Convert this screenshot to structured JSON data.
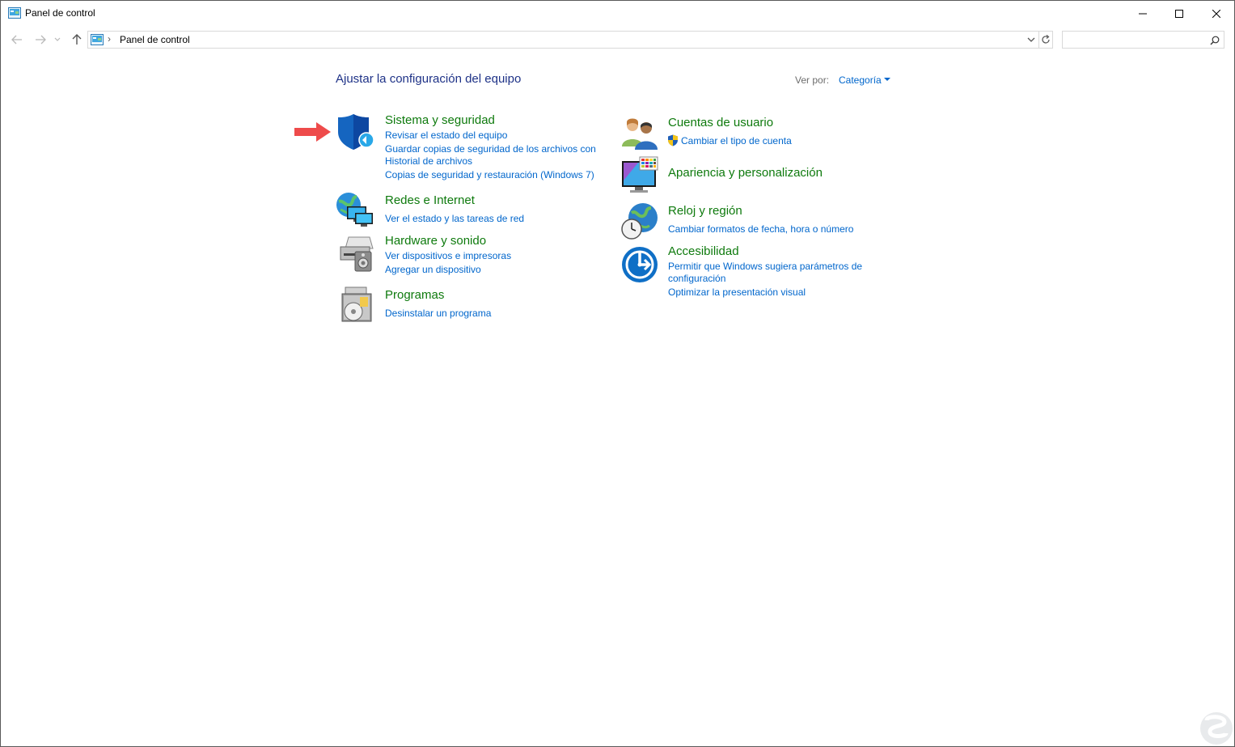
{
  "window": {
    "title": "Panel de control",
    "controls": [
      "minimize",
      "maximize",
      "close"
    ]
  },
  "nav": {
    "back_icon": "arrow-left-icon",
    "forward_icon": "arrow-right-icon",
    "recent_icon": "chevron-down-icon",
    "up_icon": "arrow-up-icon"
  },
  "address": {
    "separator": "›",
    "path": "Panel de control"
  },
  "search": {
    "placeholder": ""
  },
  "main": {
    "heading": "Ajustar la configuración del equipo",
    "view_by_label": "Ver por:",
    "view_by_value": "Categoría"
  },
  "categories_left": [
    {
      "title": "Sistema y seguridad",
      "icon": "shield-icon",
      "links": [
        "Revisar el estado del equipo",
        "Guardar copias de seguridad de los archivos con",
        "Historial de archivos",
        "Copias de seguridad y restauración (Windows 7)"
      ]
    },
    {
      "title": "Redes e Internet",
      "icon": "network-globe-icon",
      "links": [
        "Ver el estado y las tareas de red"
      ]
    },
    {
      "title": "Hardware y sonido",
      "icon": "printer-speaker-icon",
      "links": [
        "Ver dispositivos e impresoras",
        "Agregar un dispositivo"
      ]
    },
    {
      "title": "Programas",
      "icon": "programs-disc-icon",
      "links": [
        "Desinstalar un programa"
      ]
    }
  ],
  "categories_right": [
    {
      "title": "Cuentas de usuario",
      "icon": "users-icon",
      "links": [
        "Cambiar el tipo de cuenta"
      ]
    },
    {
      "title": "Apariencia y personalización",
      "icon": "monitor-palette-icon",
      "links": []
    },
    {
      "title": "Reloj y región",
      "icon": "clock-globe-icon",
      "links": [
        "Cambiar formatos de fecha, hora o número"
      ]
    },
    {
      "title": "Accesibilidad",
      "icon": "accessibility-icon",
      "links": [
        "Permitir que Windows sugiera parámetros de",
        "configuración",
        "Optimizar la presentación visual"
      ]
    }
  ],
  "colors": {
    "heading": "#1e3287",
    "category_title": "#0e7a0d",
    "link": "#0066cc",
    "arrow": "#ee4b4b"
  }
}
